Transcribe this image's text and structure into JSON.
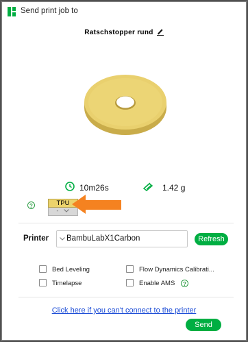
{
  "window": {
    "title": "Send print job to",
    "icon": "bambu-studio-icon",
    "accent": "#00ae42"
  },
  "job": {
    "filename": "Ratschstopper rund",
    "print_time": "10m26s",
    "weight": "1.42 g"
  },
  "filament": {
    "type": "TPU",
    "slot": "-",
    "color": "#ecd36c"
  },
  "printer": {
    "label": "Printer",
    "selected": "BambuLabX1Carbon",
    "refresh_label": "Refresh"
  },
  "options": {
    "bed_leveling": "Bed Leveling",
    "flow_calibration": "Flow Dynamics Calibrati...",
    "timelapse": "Timelapse",
    "enable_ams": "Enable AMS"
  },
  "footer": {
    "help_link": "Click here if you can't connect to the printer",
    "send_label": "Send"
  }
}
